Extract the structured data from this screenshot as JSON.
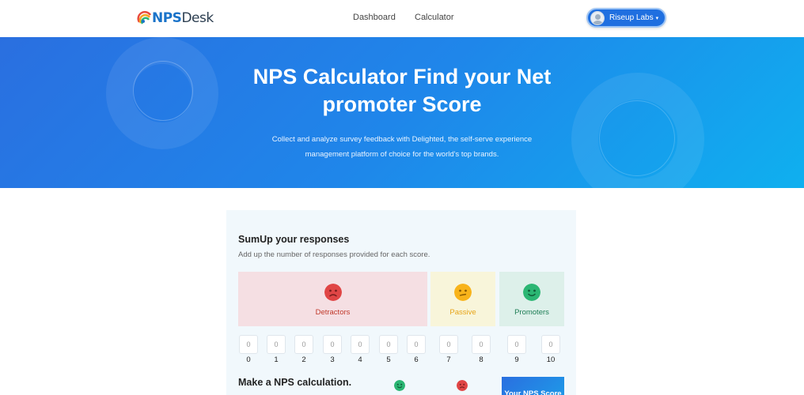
{
  "header": {
    "logo": {
      "nps": "NPS",
      "desk": "Desk"
    },
    "nav": {
      "dashboard": "Dashboard",
      "calculator": "Calculator"
    },
    "user": {
      "name": "Riseup Labs",
      "caret": "▾"
    }
  },
  "hero": {
    "title": "NPS Calculator Find your Net promoter Score",
    "subtitle": "Collect and analyze survey feedback with Delighted, the self-serve experience management platform of choice for the world's top brands."
  },
  "card": {
    "title": "SumUp your responses",
    "subtitle": "Add up the number of responses provided for each score.",
    "categories": {
      "detractors": {
        "label": "Detractors",
        "color": "#e04545",
        "icon": "sad-face-icon"
      },
      "passive": {
        "label": "Passive",
        "color": "#f8b31a",
        "icon": "neutral-face-icon"
      },
      "promoters": {
        "label": "Promoters",
        "color": "#2bb673",
        "icon": "happy-face-icon"
      }
    },
    "scores": [
      {
        "value": "0",
        "label": "0"
      },
      {
        "value": "0",
        "label": "1"
      },
      {
        "value": "0",
        "label": "2"
      },
      {
        "value": "0",
        "label": "3"
      },
      {
        "value": "0",
        "label": "4"
      },
      {
        "value": "0",
        "label": "5"
      },
      {
        "value": "0",
        "label": "6"
      },
      {
        "value": "0",
        "label": "7"
      },
      {
        "value": "0",
        "label": "8"
      },
      {
        "value": "0",
        "label": "9"
      },
      {
        "value": "0",
        "label": "10"
      }
    ],
    "calc_title": "Make a NPS calculation.",
    "nps_button": "Your NPS Score"
  }
}
